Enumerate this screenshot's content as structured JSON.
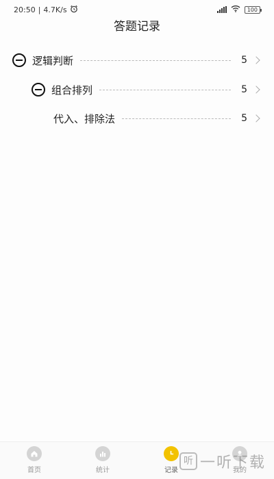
{
  "status_bar": {
    "time": "20:50",
    "speed": "4.7K/s",
    "battery": "100"
  },
  "header": {
    "title": "答题记录"
  },
  "records": [
    {
      "label": "逻辑判断",
      "count": "5"
    },
    {
      "label": "组合排列",
      "count": "5"
    },
    {
      "label": "代入、排除法",
      "count": "5"
    }
  ],
  "tabs": [
    {
      "label": "首页",
      "icon": "home-icon"
    },
    {
      "label": "统计",
      "icon": "chart-icon"
    },
    {
      "label": "记录",
      "icon": "clock-icon",
      "active": true
    },
    {
      "label": "我的",
      "icon": "user-icon"
    }
  ],
  "watermark": {
    "box": "听",
    "text": "一听下载"
  },
  "colors": {
    "accent": "#f2c200",
    "background": "#fdfdfd",
    "inactive_icon": "#d4d4d4"
  }
}
